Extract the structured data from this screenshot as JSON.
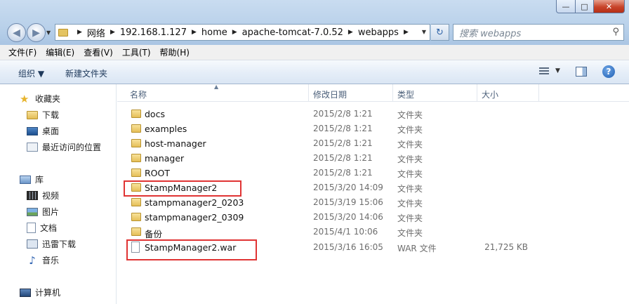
{
  "window": {
    "min_glyph": "—",
    "max_glyph": "□",
    "close_glyph": "✕"
  },
  "address": {
    "breadcrumbs": [
      "网络",
      "192.168.1.127",
      "home",
      "apache-tomcat-7.0.52",
      "webapps"
    ],
    "search_placeholder": "搜索 webapps"
  },
  "menu": [
    "文件(F)",
    "编辑(E)",
    "查看(V)",
    "工具(T)",
    "帮助(H)"
  ],
  "toolbar": {
    "organize_label": "组织 ▼",
    "new_folder_label": "新建文件夹"
  },
  "sidebar": {
    "favorites": "收藏夹",
    "favorites_items": [
      "下载",
      "桌面",
      "最近访问的位置"
    ],
    "libraries": "库",
    "library_items": [
      "视频",
      "图片",
      "文档",
      "迅雷下载",
      "音乐"
    ],
    "computer": "计算机"
  },
  "columns": {
    "name": "名称",
    "date": "修改日期",
    "type": "类型",
    "size": "大小"
  },
  "files": [
    {
      "name": "docs",
      "date": "2015/2/8 1:21",
      "type": "文件夹",
      "size": ""
    },
    {
      "name": "examples",
      "date": "2015/2/8 1:21",
      "type": "文件夹",
      "size": ""
    },
    {
      "name": "host-manager",
      "date": "2015/2/8 1:21",
      "type": "文件夹",
      "size": ""
    },
    {
      "name": "manager",
      "date": "2015/2/8 1:21",
      "type": "文件夹",
      "size": ""
    },
    {
      "name": "ROOT",
      "date": "2015/2/8 1:21",
      "type": "文件夹",
      "size": ""
    },
    {
      "name": "StampManager2",
      "date": "2015/3/20 14:09",
      "type": "文件夹",
      "size": ""
    },
    {
      "name": "stampmanager2_0203",
      "date": "2015/3/19 15:06",
      "type": "文件夹",
      "size": ""
    },
    {
      "name": "stampmanager2_0309",
      "date": "2015/3/20 14:06",
      "type": "文件夹",
      "size": ""
    },
    {
      "name": "备份",
      "date": "2015/4/1 10:06",
      "type": "文件夹",
      "size": ""
    },
    {
      "name": "StampManager2.war",
      "date": "2015/3/16 16:05",
      "type": "WAR 文件",
      "size": "21,725 KB"
    }
  ],
  "colors": {
    "highlight": "#e03434",
    "folder": "#e5bf58"
  }
}
